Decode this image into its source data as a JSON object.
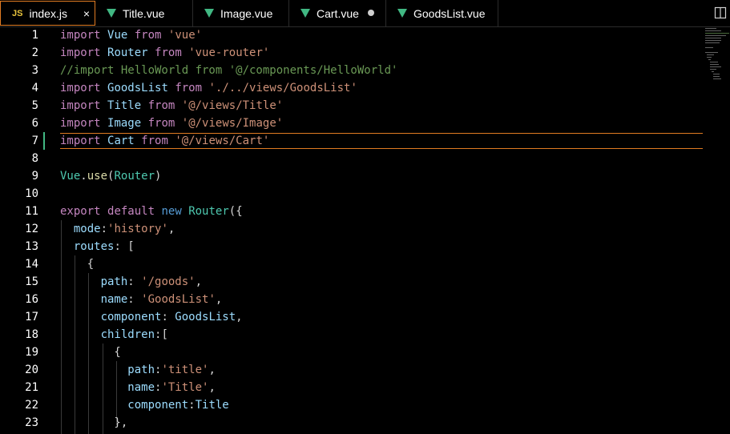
{
  "tabs": [
    {
      "label": "index.js",
      "icon": "js-icon",
      "icon_text": "JS",
      "active": true,
      "close": "×"
    },
    {
      "label": "Title.vue",
      "icon": "vue-icon",
      "active": false
    },
    {
      "label": "Image.vue",
      "icon": "vue-icon",
      "active": false
    },
    {
      "label": "Cart.vue",
      "icon": "vue-icon",
      "active": false,
      "modified": true
    },
    {
      "label": "GoodsList.vue",
      "icon": "vue-icon",
      "active": false
    }
  ],
  "editor": {
    "current_line": 7,
    "lines": [
      {
        "n": "1",
        "code": "import Vue from 'vue'"
      },
      {
        "n": "2",
        "code": "import Router from 'vue-router'"
      },
      {
        "n": "3",
        "code": "//import HelloWorld from '@/components/HelloWorld'"
      },
      {
        "n": "4",
        "code": "import GoodsList from './../views/GoodsList'"
      },
      {
        "n": "5",
        "code": "import Title from '@/views/Title'"
      },
      {
        "n": "6",
        "code": "import Image from '@/views/Image'"
      },
      {
        "n": "7",
        "code": "import Cart from '@/views/Cart'"
      },
      {
        "n": "8",
        "code": ""
      },
      {
        "n": "9",
        "code": "Vue.use(Router)"
      },
      {
        "n": "10",
        "code": ""
      },
      {
        "n": "11",
        "code": "export default new Router({"
      },
      {
        "n": "12",
        "code": "  mode:'history',"
      },
      {
        "n": "13",
        "code": "  routes: ["
      },
      {
        "n": "14",
        "code": "    {"
      },
      {
        "n": "15",
        "code": "      path: '/goods',"
      },
      {
        "n": "16",
        "code": "      name: 'GoodsList',"
      },
      {
        "n": "17",
        "code": "      component: GoodsList,"
      },
      {
        "n": "18",
        "code": "      children:["
      },
      {
        "n": "19",
        "code": "        {"
      },
      {
        "n": "20",
        "code": "          path:'title',"
      },
      {
        "n": "21",
        "code": "          name:'Title',"
      },
      {
        "n": "22",
        "code": "          component:Title"
      },
      {
        "n": "23",
        "code": "        },"
      }
    ]
  },
  "colors": {
    "accent": "#e07b22",
    "vue": "#41b883"
  }
}
